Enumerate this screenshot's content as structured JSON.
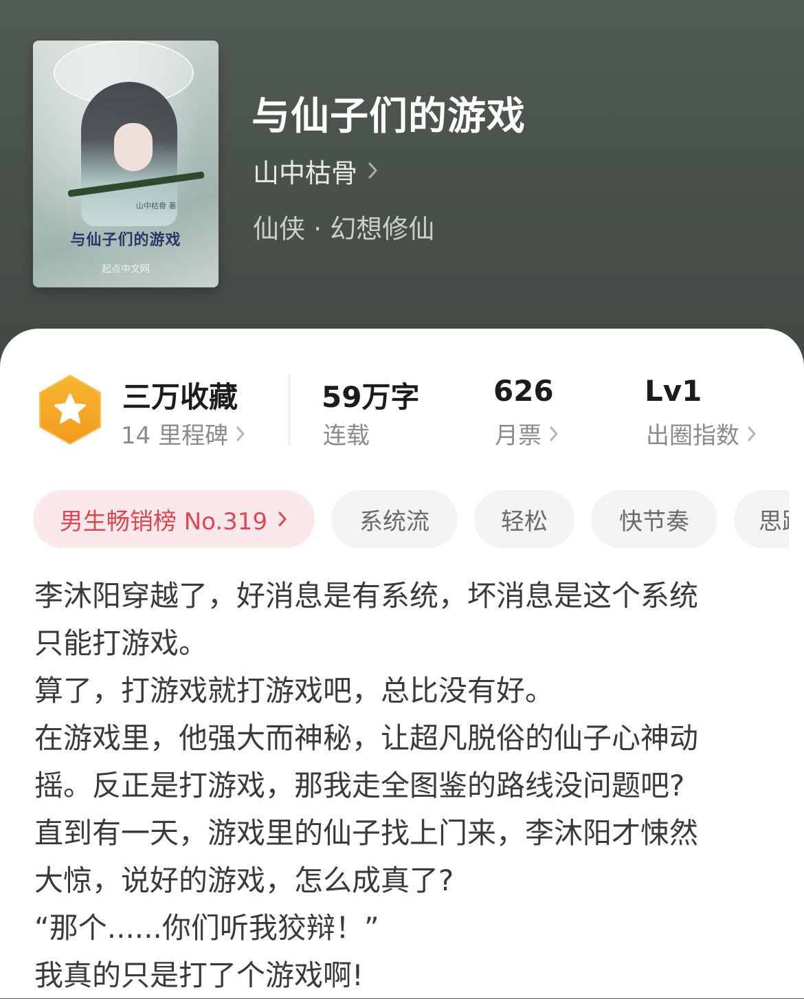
{
  "book": {
    "cover_title": "与仙子们的游戏",
    "cover_author_mark": "山中枯骨 著",
    "cover_publisher": "起点中文网",
    "title": "与仙子们的游戏",
    "author": "山中枯骨",
    "genre": "仙侠 · 幻想修仙"
  },
  "stats": {
    "favorites": {
      "title": "三万收藏",
      "sub": "14 里程碑"
    },
    "words": {
      "title": "59万字",
      "sub": "连载"
    },
    "monthly_votes": {
      "title": "626",
      "sub": "月票"
    },
    "level": {
      "title": "Lv1",
      "sub": "出圈指数"
    }
  },
  "tags": {
    "rank": "男生畅销榜 No.319",
    "items": [
      "系统流",
      "轻松",
      "快节奏",
      "思路"
    ]
  },
  "description": [
    "李沐阳穿越了，好消息是有系统，坏消息是这个系统",
    "只能打游戏。",
    "算了，打游戏就打游戏吧，总比没有好。",
    "在游戏里，他强大而神秘，让超凡脱俗的仙子心神动",
    "摇。反正是打游戏，那我走全图鉴的路线没问题吧?",
    "直到有一天，游戏里的仙子找上门来，李沐阳才悚然",
    "大惊，说好的游戏，怎么成真了?",
    "“那个......你们听我狡辩！”",
    "我真的只是打了个游戏啊!"
  ],
  "colors": {
    "header_bg": "#4a524c",
    "badge": "#f5a623",
    "rank_bg": "#fbe8ea",
    "rank_text": "#e04552"
  },
  "icons": {
    "chevron": "chevron-right-icon",
    "badge": "star-hexagon-icon"
  }
}
